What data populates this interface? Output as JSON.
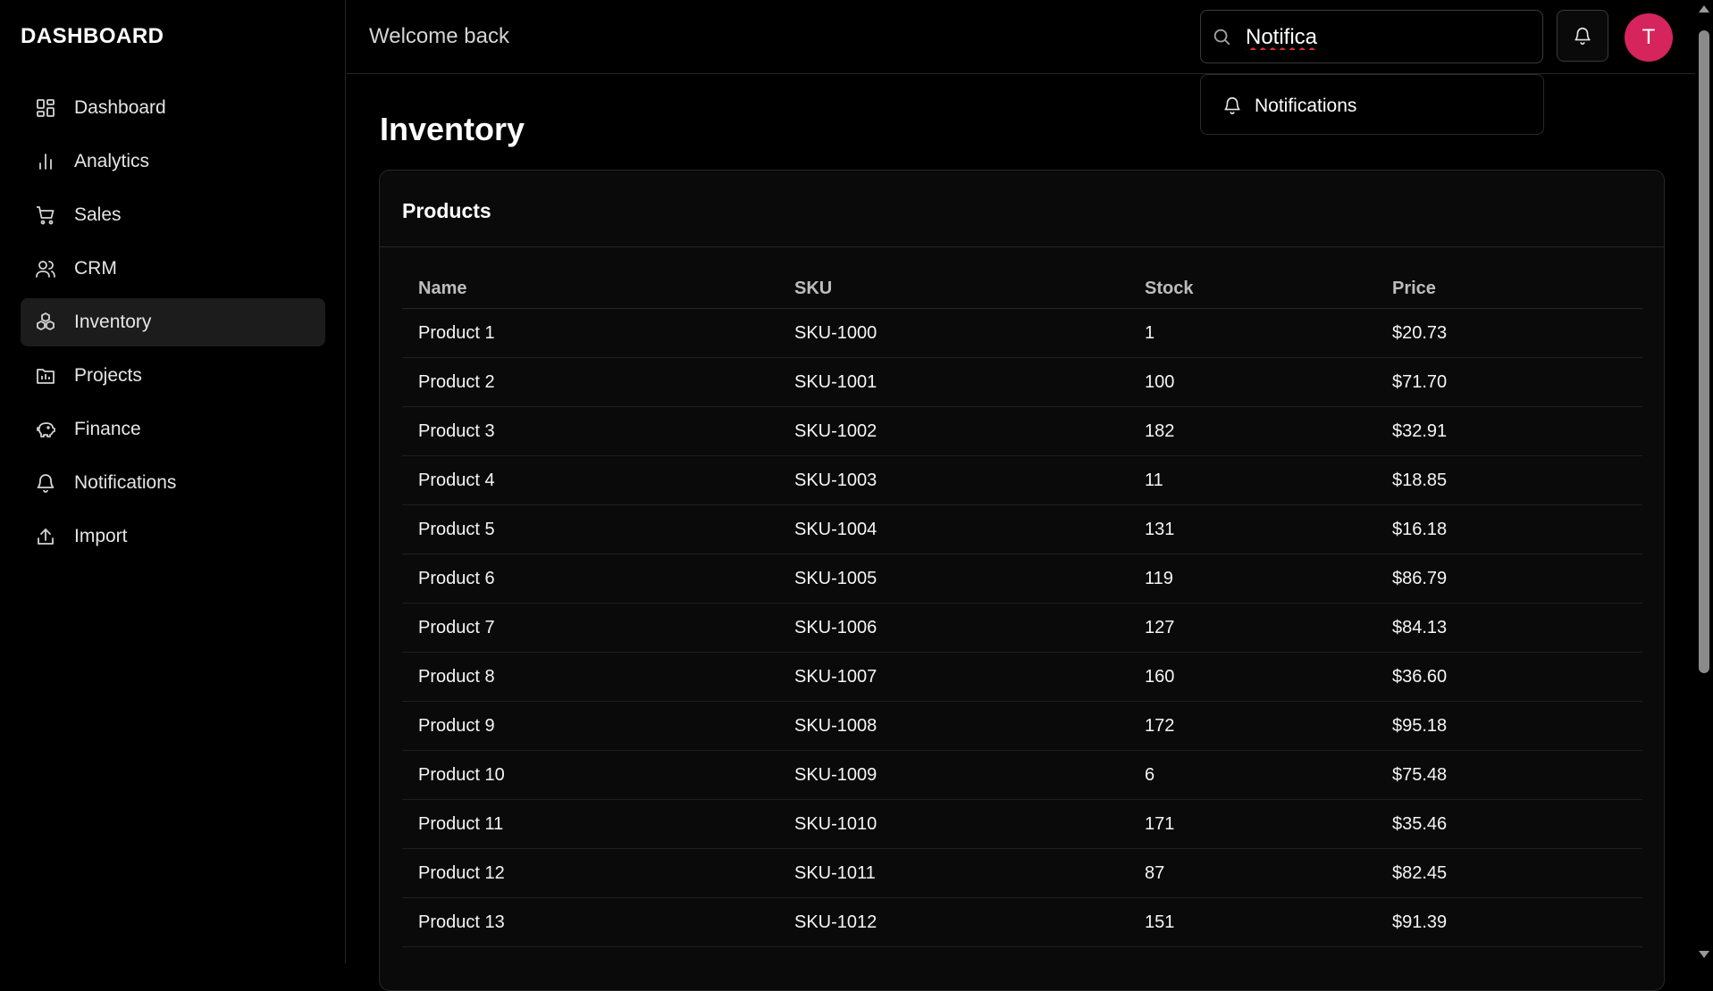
{
  "brand": "DASHBOARD",
  "sidebar": {
    "items": [
      {
        "label": "Dashboard",
        "icon": "grid-icon",
        "active": false
      },
      {
        "label": "Analytics",
        "icon": "bar-chart-icon",
        "active": false
      },
      {
        "label": "Sales",
        "icon": "cart-icon",
        "active": false
      },
      {
        "label": "CRM",
        "icon": "users-icon",
        "active": false
      },
      {
        "label": "Inventory",
        "icon": "boxes-icon",
        "active": true
      },
      {
        "label": "Projects",
        "icon": "folder-icon",
        "active": false
      },
      {
        "label": "Finance",
        "icon": "piggy-bank-icon",
        "active": false
      },
      {
        "label": "Notifications",
        "icon": "bell-icon",
        "active": false
      },
      {
        "label": "Import",
        "icon": "upload-icon",
        "active": false
      }
    ]
  },
  "header": {
    "welcome": "Welcome back",
    "search": {
      "value": "Notifica",
      "icon": "search-icon"
    },
    "notifications_icon": "bell-icon",
    "avatar_initial": "T",
    "avatar_color": "#d6245c"
  },
  "search_dropdown": {
    "items": [
      {
        "label": "Notifications",
        "icon": "bell-icon"
      }
    ]
  },
  "page": {
    "title": "Inventory",
    "card_title": "Products",
    "table": {
      "headers": [
        "Name",
        "SKU",
        "Stock",
        "Price"
      ],
      "rows": [
        [
          "Product 1",
          "SKU-1000",
          "1",
          "$20.73"
        ],
        [
          "Product 2",
          "SKU-1001",
          "100",
          "$71.70"
        ],
        [
          "Product 3",
          "SKU-1002",
          "182",
          "$32.91"
        ],
        [
          "Product 4",
          "SKU-1003",
          "11",
          "$18.85"
        ],
        [
          "Product 5",
          "SKU-1004",
          "131",
          "$16.18"
        ],
        [
          "Product 6",
          "SKU-1005",
          "119",
          "$86.79"
        ],
        [
          "Product 7",
          "SKU-1006",
          "127",
          "$84.13"
        ],
        [
          "Product 8",
          "SKU-1007",
          "160",
          "$36.60"
        ],
        [
          "Product 9",
          "SKU-1008",
          "172",
          "$95.18"
        ],
        [
          "Product 10",
          "SKU-1009",
          "6",
          "$75.48"
        ],
        [
          "Product 11",
          "SKU-1010",
          "171",
          "$35.46"
        ],
        [
          "Product 12",
          "SKU-1011",
          "87",
          "$82.45"
        ],
        [
          "Product 13",
          "SKU-1012",
          "151",
          "$91.39"
        ]
      ]
    }
  }
}
